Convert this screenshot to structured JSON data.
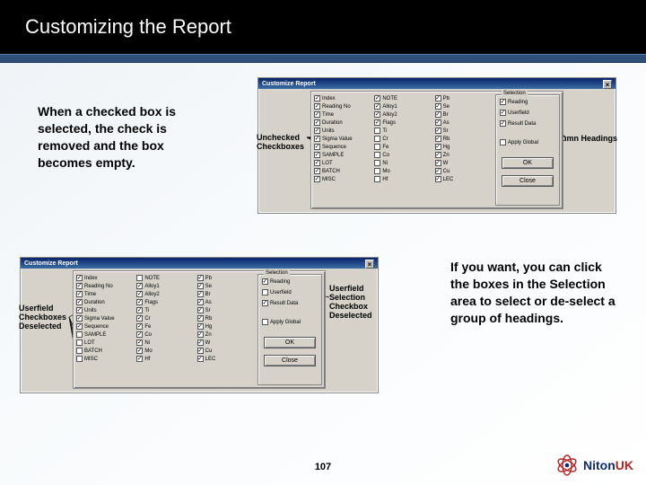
{
  "slide": {
    "title": "Customizing the Report",
    "page_number": "107",
    "para1": "When a checked box is selected, the check is removed and the box becomes empty.",
    "para2": "If you want, you can click the boxes in the Selection area to select or de-select a group of headings."
  },
  "logo": {
    "niton": "Niton",
    "uk": "UK"
  },
  "shot_common": {
    "window_title": "Customize Report",
    "selection_label": "Selection",
    "sel_reading": "Reading",
    "sel_userfield": "Userfield",
    "sel_resultdata": "Result Data",
    "apply_global": "Apply Global",
    "ok": "OK",
    "close": "Close"
  },
  "shot1": {
    "annot_left": "Unchecked Checkboxes",
    "annot_right": "Column Headings",
    "col1": [
      {
        "c": true,
        "l": "Index"
      },
      {
        "c": true,
        "l": "Reading No"
      },
      {
        "c": true,
        "l": "Time"
      },
      {
        "c": true,
        "l": "Duration"
      },
      {
        "c": true,
        "l": "Units"
      },
      {
        "c": true,
        "l": "Sigma Value"
      },
      {
        "c": true,
        "l": "Sequence"
      },
      {
        "c": true,
        "l": "SAMPLE"
      },
      {
        "c": true,
        "l": "LOT"
      },
      {
        "c": true,
        "l": "BATCH"
      },
      {
        "c": true,
        "l": "MISC"
      }
    ],
    "col2": [
      {
        "c": true,
        "l": "NOTE"
      },
      {
        "c": true,
        "l": "Alloy1"
      },
      {
        "c": true,
        "l": "Alloy2"
      },
      {
        "c": true,
        "l": "Flags"
      },
      {
        "c": false,
        "l": "Ti"
      },
      {
        "c": false,
        "l": "Cr"
      },
      {
        "c": false,
        "l": "Fe"
      },
      {
        "c": false,
        "l": "Co"
      },
      {
        "c": false,
        "l": "Ni"
      },
      {
        "c": false,
        "l": "Mo"
      },
      {
        "c": false,
        "l": "Hf"
      }
    ],
    "col3": [
      {
        "c": true,
        "l": "Pb"
      },
      {
        "c": true,
        "l": "Se"
      },
      {
        "c": true,
        "l": "Br"
      },
      {
        "c": true,
        "l": "As"
      },
      {
        "c": true,
        "l": "Sr"
      },
      {
        "c": true,
        "l": "Rb"
      },
      {
        "c": true,
        "l": "Hg"
      },
      {
        "c": true,
        "l": "Zn"
      },
      {
        "c": true,
        "l": "W"
      },
      {
        "c": true,
        "l": "Cu"
      },
      {
        "c": true,
        "l": "LEC"
      }
    ],
    "sel_reading_on": true,
    "sel_userfield_on": true,
    "sel_resultdata_on": true,
    "apply_on": false
  },
  "shot2": {
    "annot_left": "Userfield Checkboxes Deselected",
    "annot_right": "Userfield Selection Checkbox Deselected",
    "col1": [
      {
        "c": true,
        "l": "Index"
      },
      {
        "c": true,
        "l": "Reading No"
      },
      {
        "c": true,
        "l": "Time"
      },
      {
        "c": true,
        "l": "Duration"
      },
      {
        "c": true,
        "l": "Units"
      },
      {
        "c": true,
        "l": "Sigma Value"
      },
      {
        "c": true,
        "l": "Sequence"
      },
      {
        "c": false,
        "l": "SAMPLE"
      },
      {
        "c": false,
        "l": "LOT"
      },
      {
        "c": false,
        "l": "BATCH"
      },
      {
        "c": false,
        "l": "MISC"
      }
    ],
    "col2": [
      {
        "c": false,
        "l": "NOTE"
      },
      {
        "c": true,
        "l": "Alloy1"
      },
      {
        "c": true,
        "l": "Alloy2"
      },
      {
        "c": true,
        "l": "Flags"
      },
      {
        "c": true,
        "l": "Ti"
      },
      {
        "c": true,
        "l": "Cr"
      },
      {
        "c": true,
        "l": "Fe"
      },
      {
        "c": true,
        "l": "Co"
      },
      {
        "c": true,
        "l": "Ni"
      },
      {
        "c": true,
        "l": "Mo"
      },
      {
        "c": true,
        "l": "Hf"
      }
    ],
    "col3": [
      {
        "c": true,
        "l": "Pb"
      },
      {
        "c": true,
        "l": "Se"
      },
      {
        "c": true,
        "l": "Br"
      },
      {
        "c": true,
        "l": "As"
      },
      {
        "c": true,
        "l": "Sr"
      },
      {
        "c": true,
        "l": "Rb"
      },
      {
        "c": true,
        "l": "Hg"
      },
      {
        "c": true,
        "l": "Zn"
      },
      {
        "c": true,
        "l": "W"
      },
      {
        "c": true,
        "l": "Cu"
      },
      {
        "c": true,
        "l": "LEC"
      }
    ],
    "sel_reading_on": true,
    "sel_userfield_on": false,
    "sel_resultdata_on": true,
    "apply_on": false
  }
}
